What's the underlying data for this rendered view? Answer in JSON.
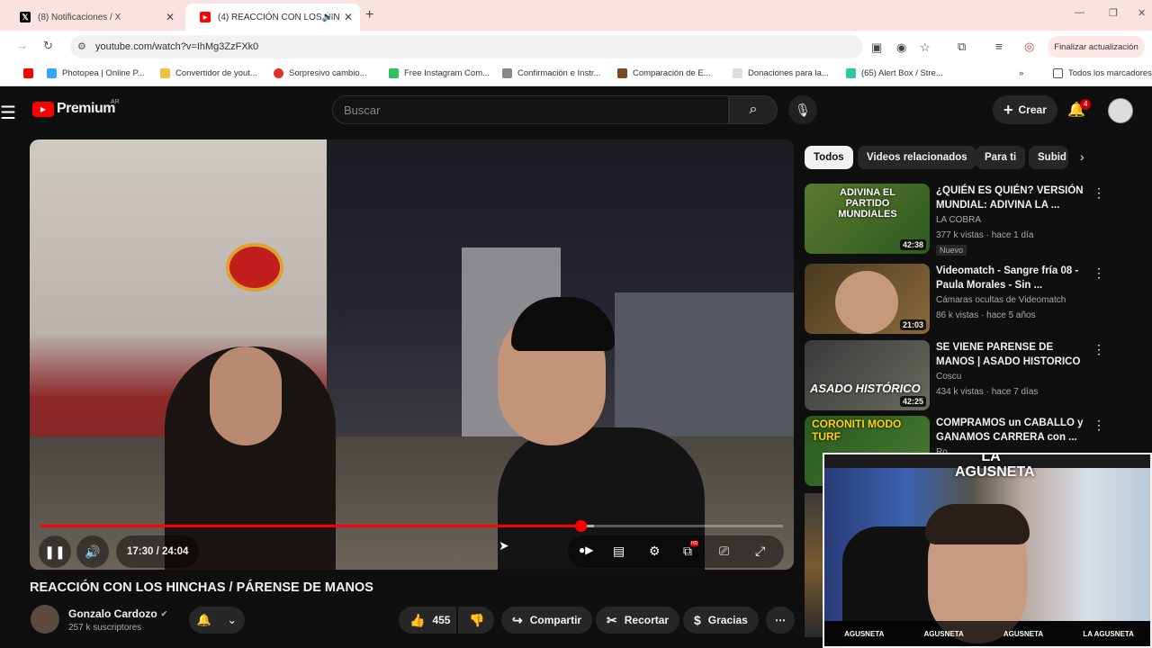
{
  "browser": {
    "tabs": [
      {
        "title": "(8) Notificaciones / X",
        "icon": "X"
      },
      {
        "title": "(4) REACCIÓN CON LOS HIN",
        "icon": "yt"
      }
    ],
    "url": "youtube.com/watch?v=IhMg3ZzFXk0",
    "update_label": "Finalizar actualización",
    "bookmarks": [
      "Photopea | Online P...",
      "Convertidor de yout...",
      "Sorpresivo cambio...",
      "Free Instagram Com...",
      "Confirmación e Instr...",
      "Comparación de E...",
      "Donaciones para la...",
      "(65) Alert Box / Stre..."
    ],
    "all_bookmarks": "Todos los marcadores"
  },
  "youtube": {
    "logo_text": "Premium",
    "logo_region": "AR",
    "search_placeholder": "Buscar",
    "create_label": "Crear",
    "notif_count": "4"
  },
  "player": {
    "time": "17:30 / 24:04",
    "progress": 0.727,
    "buffered": 0.745
  },
  "video": {
    "title": "REACCIÓN CON LOS HINCHAS / PÁRENSE DE MANOS",
    "channel": "Gonzalo Cardozo",
    "subs": "257 k suscriptores",
    "likes": "455",
    "share": "Compartir",
    "clip": "Recortar",
    "thanks": "Gracias"
  },
  "chips": [
    "Todos",
    "Videos relacionados",
    "Para ti",
    "Subid"
  ],
  "recommended": [
    {
      "title": "¿QUIÉN ES QUIÉN? VERSIÓN MUNDIAL: ADIVINA LA ...",
      "channel": "LA COBRA",
      "meta": "377 k vistas · hace 1 día",
      "duration": "42:38",
      "badge": "Nuevo",
      "thumb_text": "ADIVINA EL PARTIDO MUNDIALES"
    },
    {
      "title": "Videomatch - Sangre fría 08 - Paula Morales - Sin ...",
      "channel": "Cámaras ocultas de Videomatch",
      "meta": "86 k vistas · hace 5 años",
      "duration": "21:03",
      "badge": "",
      "thumb_text": ""
    },
    {
      "title": "SE VIENE PARENSE DE MANOS | ASADO HISTORICO",
      "channel": "Coscu",
      "meta": "434 k vistas · hace 7 días",
      "duration": "42:25",
      "badge": "",
      "thumb_text": "ASADO HISTÓRICO"
    },
    {
      "title": "COMPRAMOS un CABALLO y GANAMOS CARRERA con ...",
      "channel": "Ro...",
      "meta": "",
      "duration": "",
      "badge": "",
      "thumb_text": "CORONITI MODO TURF"
    }
  ],
  "cam": {
    "logo": "LA AGUSNETA",
    "socials": [
      "AGUSNETA",
      "AGUSNETA",
      "AGUSNETA",
      "LA AGUSNETA"
    ]
  }
}
